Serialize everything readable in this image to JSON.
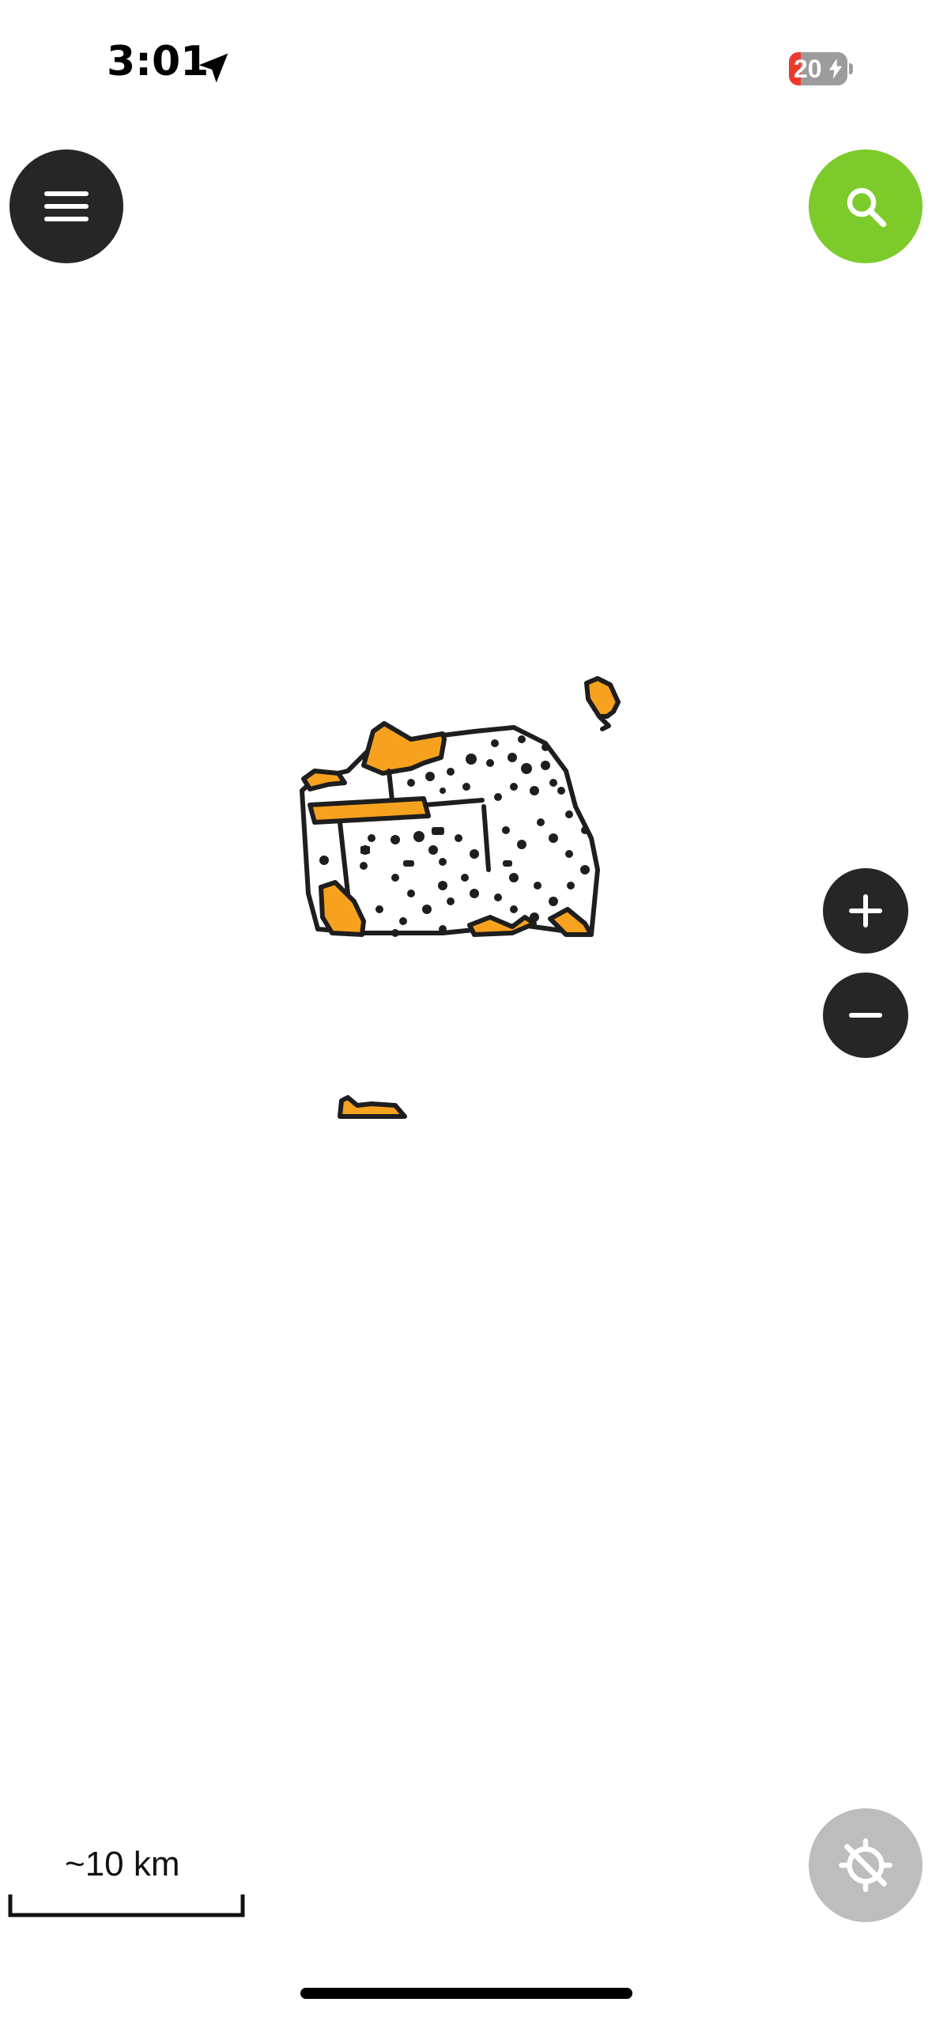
{
  "status_bar": {
    "time": "3:01",
    "battery_level": "20",
    "battery_fraction": 0.2,
    "charging": true,
    "location_icon": "location-arrow-icon"
  },
  "toolbar": {
    "menu_icon": "hamburger-menu-icon",
    "search_icon": "search-icon"
  },
  "map": {
    "region_fill_color": "#f7a21e",
    "outline_color": "#1e1e1e",
    "background_color": "#ffffff"
  },
  "zoom_controls": {
    "zoom_in_icon": "plus-icon",
    "zoom_out_icon": "minus-icon"
  },
  "location_control": {
    "icon": "location-disabled-icon",
    "enabled": false
  },
  "scale": {
    "label": "~10 km"
  },
  "colors": {
    "accent": "#7dcb2b",
    "button_dark": "#262626",
    "button_disabled": "#bdbdbd",
    "battery_low": "#ec3b2e"
  }
}
